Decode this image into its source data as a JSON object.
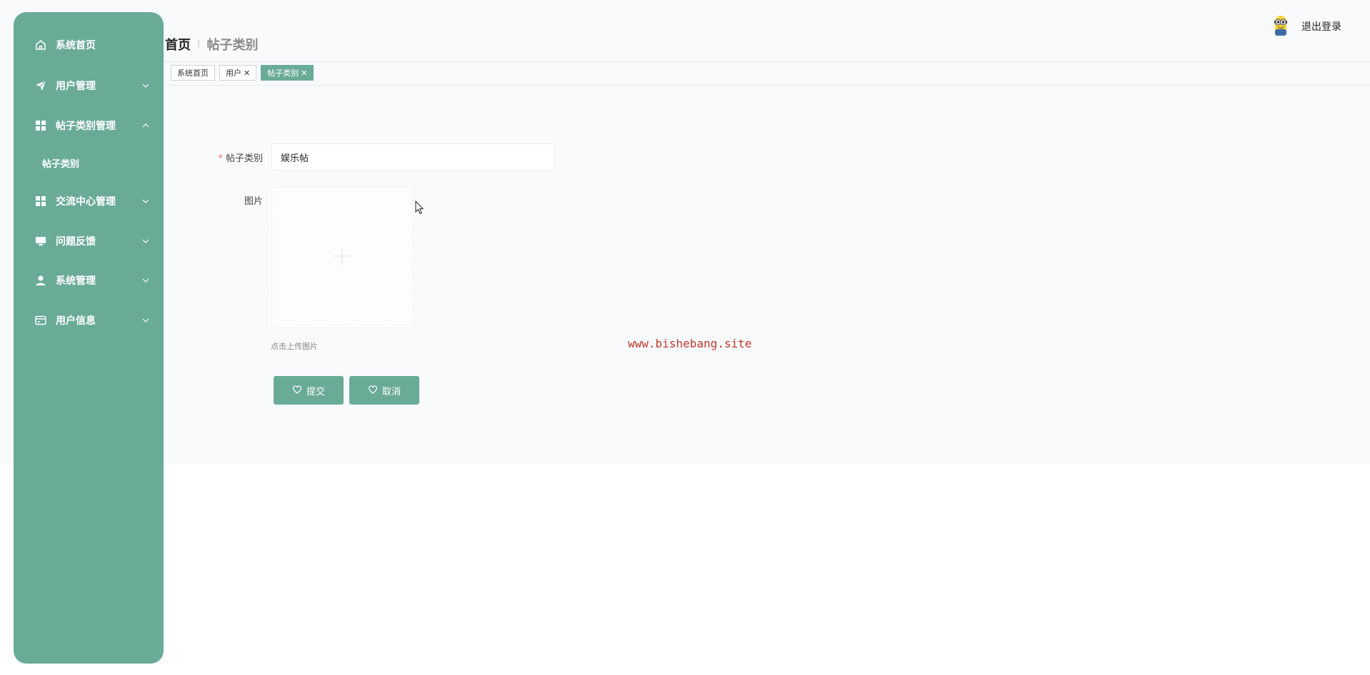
{
  "sidebar": {
    "items": [
      {
        "label": "系统首页",
        "icon": "home-icon",
        "expandable": false
      },
      {
        "label": "用户管理",
        "icon": "paper-plane-icon",
        "expandable": true,
        "expanded": false
      },
      {
        "label": "帖子类别管理",
        "icon": "grid-icon",
        "expandable": true,
        "expanded": true,
        "children": [
          {
            "label": "帖子类别"
          }
        ]
      },
      {
        "label": "交流中心管理",
        "icon": "grid-icon",
        "expandable": true,
        "expanded": false
      },
      {
        "label": "问题反馈",
        "icon": "monitor-icon",
        "expandable": true,
        "expanded": false
      },
      {
        "label": "系统管理",
        "icon": "user-icon",
        "expandable": true,
        "expanded": false
      },
      {
        "label": "用户信息",
        "icon": "card-icon",
        "expandable": true,
        "expanded": false
      }
    ]
  },
  "header": {
    "breadcrumb_home": "首页",
    "breadcrumb_current": "帖子类别",
    "logout": "退出登录"
  },
  "tags": [
    {
      "label": "系统首页",
      "closable": false,
      "active": false
    },
    {
      "label": "用户",
      "closable": true,
      "active": false
    },
    {
      "label": "帖子类别",
      "closable": true,
      "active": true
    }
  ],
  "form": {
    "category_label": "帖子类别",
    "category_value": "娱乐帖",
    "image_label": "图片",
    "upload_hint": "点击上传图片",
    "submit_label": "提交",
    "cancel_label": "取消"
  },
  "watermark": "www.bishebang.site",
  "colors": {
    "accent": "#6aab98",
    "required": "#f56c6c",
    "watermark": "#c0392b"
  }
}
